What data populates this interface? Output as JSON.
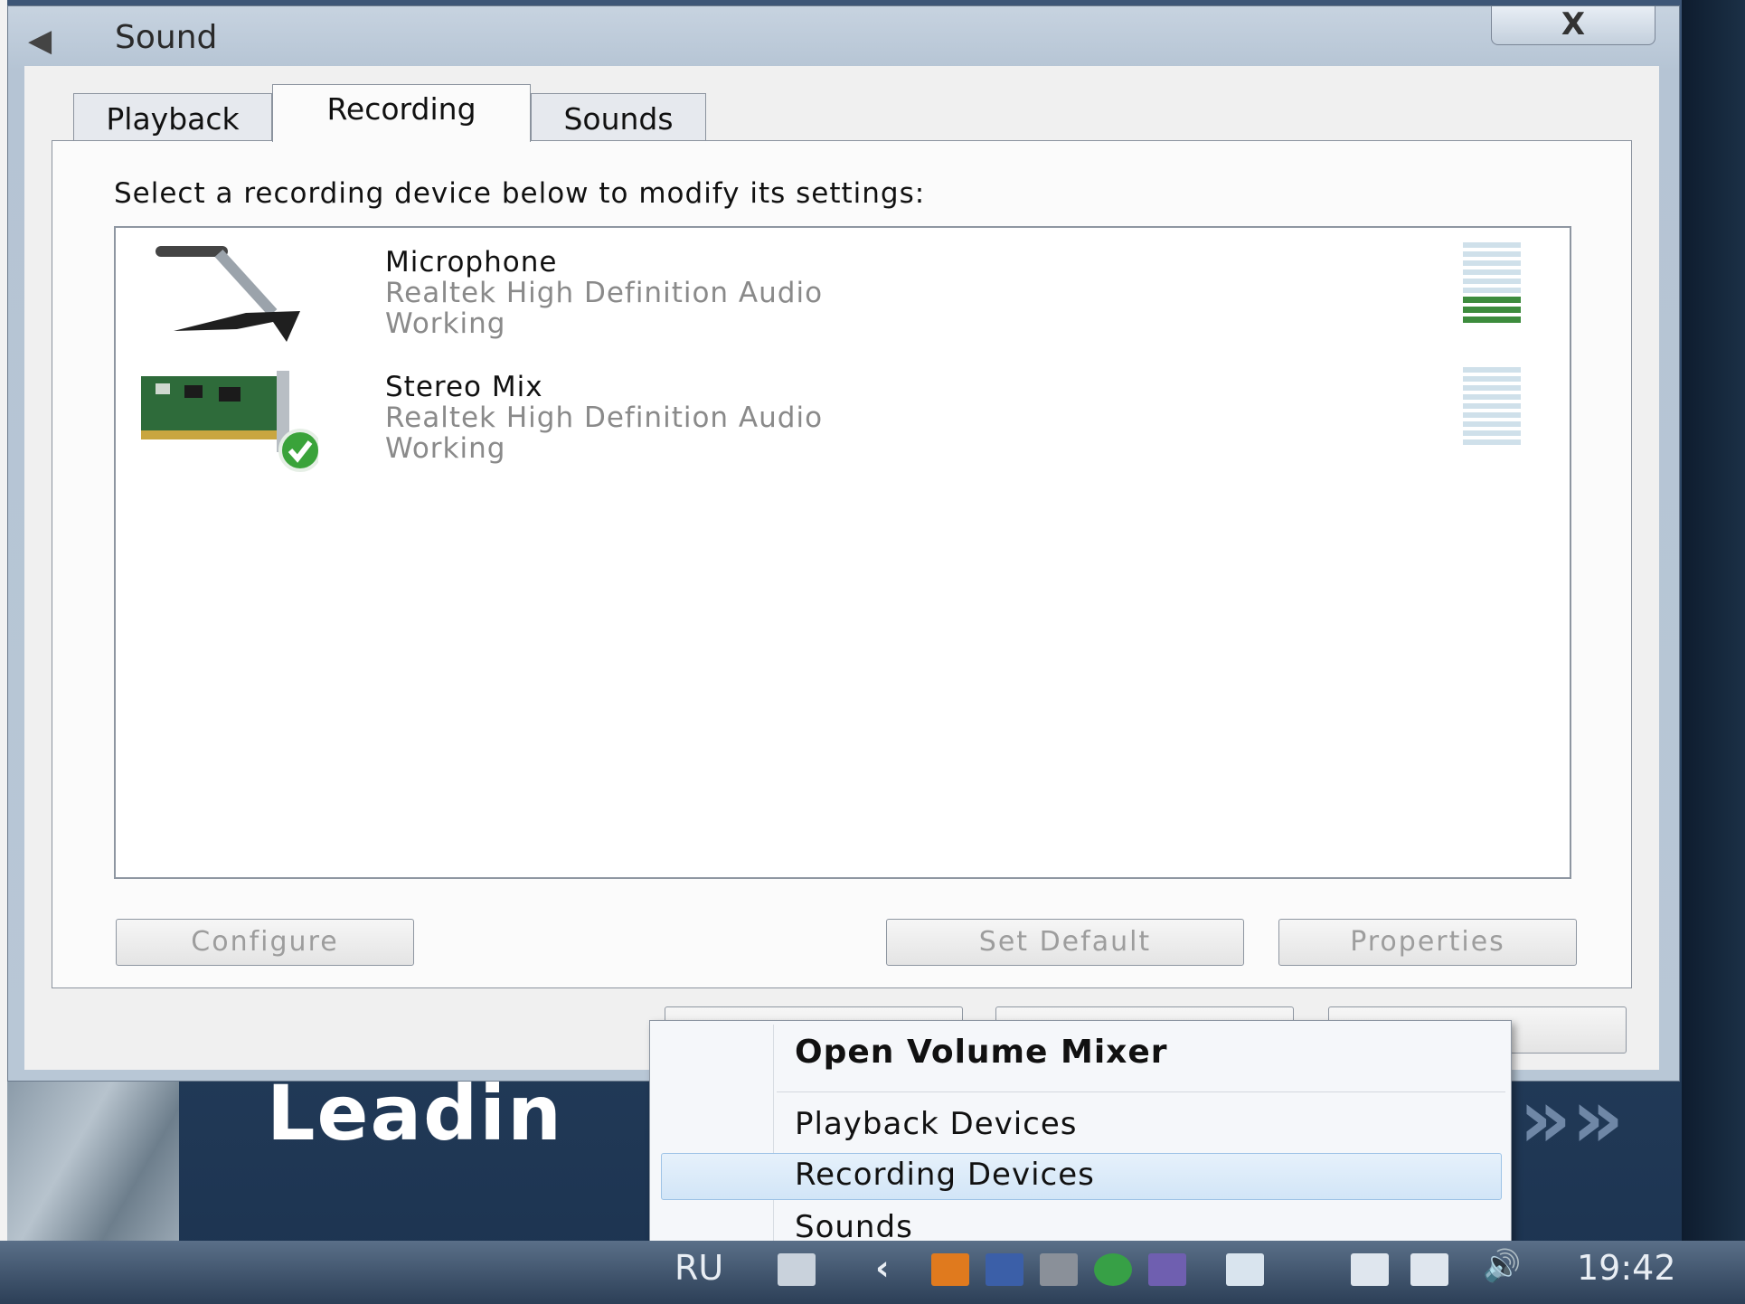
{
  "window": {
    "title": "Sound",
    "close_label": "X"
  },
  "tabs": [
    {
      "label": "Playback",
      "active": false
    },
    {
      "label": "Recording",
      "active": true
    },
    {
      "label": "Sounds",
      "active": false
    }
  ],
  "instruction": "Select a recording device below to modify its settings:",
  "devices": [
    {
      "name": "Microphone",
      "driver": "Realtek High Definition Audio",
      "status": "Working",
      "icon": "microphone-icon",
      "level_fraction": 0.2,
      "default": false
    },
    {
      "name": "Stereo Mix",
      "driver": "Realtek High Definition Audio",
      "status": "Working",
      "icon": "sound-card-icon",
      "level_fraction": 0.0,
      "default": true
    }
  ],
  "panel_buttons": {
    "configure": "Configure",
    "set_default": "Set Default",
    "properties": "Properties"
  },
  "context_menu": {
    "items": [
      {
        "label": "Open Volume Mixer",
        "bold": true
      },
      {
        "label": "Playback Devices",
        "bold": false
      },
      {
        "label": "Recording Devices",
        "bold": false,
        "highlighted": true
      },
      {
        "label": "Sounds",
        "bold": false
      }
    ]
  },
  "desktop": {
    "banner_text": "Leadin"
  },
  "taskbar": {
    "language": "RU",
    "clock": "19:42"
  },
  "colors": {
    "meter_active": "#3d8c3d",
    "menu_highlight": "#d2e5f7"
  }
}
